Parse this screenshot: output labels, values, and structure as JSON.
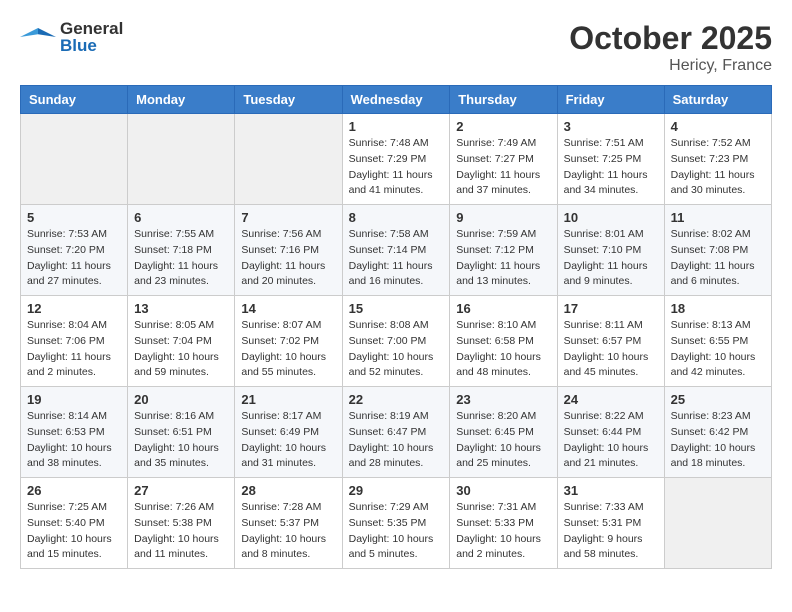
{
  "header": {
    "logo_general": "General",
    "logo_blue": "Blue",
    "month": "October 2025",
    "location": "Hericy, France"
  },
  "days_of_week": [
    "Sunday",
    "Monday",
    "Tuesday",
    "Wednesday",
    "Thursday",
    "Friday",
    "Saturday"
  ],
  "weeks": [
    [
      {
        "num": "",
        "info": ""
      },
      {
        "num": "",
        "info": ""
      },
      {
        "num": "",
        "info": ""
      },
      {
        "num": "1",
        "info": "Sunrise: 7:48 AM\nSunset: 7:29 PM\nDaylight: 11 hours and 41 minutes."
      },
      {
        "num": "2",
        "info": "Sunrise: 7:49 AM\nSunset: 7:27 PM\nDaylight: 11 hours and 37 minutes."
      },
      {
        "num": "3",
        "info": "Sunrise: 7:51 AM\nSunset: 7:25 PM\nDaylight: 11 hours and 34 minutes."
      },
      {
        "num": "4",
        "info": "Sunrise: 7:52 AM\nSunset: 7:23 PM\nDaylight: 11 hours and 30 minutes."
      }
    ],
    [
      {
        "num": "5",
        "info": "Sunrise: 7:53 AM\nSunset: 7:20 PM\nDaylight: 11 hours and 27 minutes."
      },
      {
        "num": "6",
        "info": "Sunrise: 7:55 AM\nSunset: 7:18 PM\nDaylight: 11 hours and 23 minutes."
      },
      {
        "num": "7",
        "info": "Sunrise: 7:56 AM\nSunset: 7:16 PM\nDaylight: 11 hours and 20 minutes."
      },
      {
        "num": "8",
        "info": "Sunrise: 7:58 AM\nSunset: 7:14 PM\nDaylight: 11 hours and 16 minutes."
      },
      {
        "num": "9",
        "info": "Sunrise: 7:59 AM\nSunset: 7:12 PM\nDaylight: 11 hours and 13 minutes."
      },
      {
        "num": "10",
        "info": "Sunrise: 8:01 AM\nSunset: 7:10 PM\nDaylight: 11 hours and 9 minutes."
      },
      {
        "num": "11",
        "info": "Sunrise: 8:02 AM\nSunset: 7:08 PM\nDaylight: 11 hours and 6 minutes."
      }
    ],
    [
      {
        "num": "12",
        "info": "Sunrise: 8:04 AM\nSunset: 7:06 PM\nDaylight: 11 hours and 2 minutes."
      },
      {
        "num": "13",
        "info": "Sunrise: 8:05 AM\nSunset: 7:04 PM\nDaylight: 10 hours and 59 minutes."
      },
      {
        "num": "14",
        "info": "Sunrise: 8:07 AM\nSunset: 7:02 PM\nDaylight: 10 hours and 55 minutes."
      },
      {
        "num": "15",
        "info": "Sunrise: 8:08 AM\nSunset: 7:00 PM\nDaylight: 10 hours and 52 minutes."
      },
      {
        "num": "16",
        "info": "Sunrise: 8:10 AM\nSunset: 6:58 PM\nDaylight: 10 hours and 48 minutes."
      },
      {
        "num": "17",
        "info": "Sunrise: 8:11 AM\nSunset: 6:57 PM\nDaylight: 10 hours and 45 minutes."
      },
      {
        "num": "18",
        "info": "Sunrise: 8:13 AM\nSunset: 6:55 PM\nDaylight: 10 hours and 42 minutes."
      }
    ],
    [
      {
        "num": "19",
        "info": "Sunrise: 8:14 AM\nSunset: 6:53 PM\nDaylight: 10 hours and 38 minutes."
      },
      {
        "num": "20",
        "info": "Sunrise: 8:16 AM\nSunset: 6:51 PM\nDaylight: 10 hours and 35 minutes."
      },
      {
        "num": "21",
        "info": "Sunrise: 8:17 AM\nSunset: 6:49 PM\nDaylight: 10 hours and 31 minutes."
      },
      {
        "num": "22",
        "info": "Sunrise: 8:19 AM\nSunset: 6:47 PM\nDaylight: 10 hours and 28 minutes."
      },
      {
        "num": "23",
        "info": "Sunrise: 8:20 AM\nSunset: 6:45 PM\nDaylight: 10 hours and 25 minutes."
      },
      {
        "num": "24",
        "info": "Sunrise: 8:22 AM\nSunset: 6:44 PM\nDaylight: 10 hours and 21 minutes."
      },
      {
        "num": "25",
        "info": "Sunrise: 8:23 AM\nSunset: 6:42 PM\nDaylight: 10 hours and 18 minutes."
      }
    ],
    [
      {
        "num": "26",
        "info": "Sunrise: 7:25 AM\nSunset: 5:40 PM\nDaylight: 10 hours and 15 minutes."
      },
      {
        "num": "27",
        "info": "Sunrise: 7:26 AM\nSunset: 5:38 PM\nDaylight: 10 hours and 11 minutes."
      },
      {
        "num": "28",
        "info": "Sunrise: 7:28 AM\nSunset: 5:37 PM\nDaylight: 10 hours and 8 minutes."
      },
      {
        "num": "29",
        "info": "Sunrise: 7:29 AM\nSunset: 5:35 PM\nDaylight: 10 hours and 5 minutes."
      },
      {
        "num": "30",
        "info": "Sunrise: 7:31 AM\nSunset: 5:33 PM\nDaylight: 10 hours and 2 minutes."
      },
      {
        "num": "31",
        "info": "Sunrise: 7:33 AM\nSunset: 5:31 PM\nDaylight: 9 hours and 58 minutes."
      },
      {
        "num": "",
        "info": ""
      }
    ]
  ]
}
